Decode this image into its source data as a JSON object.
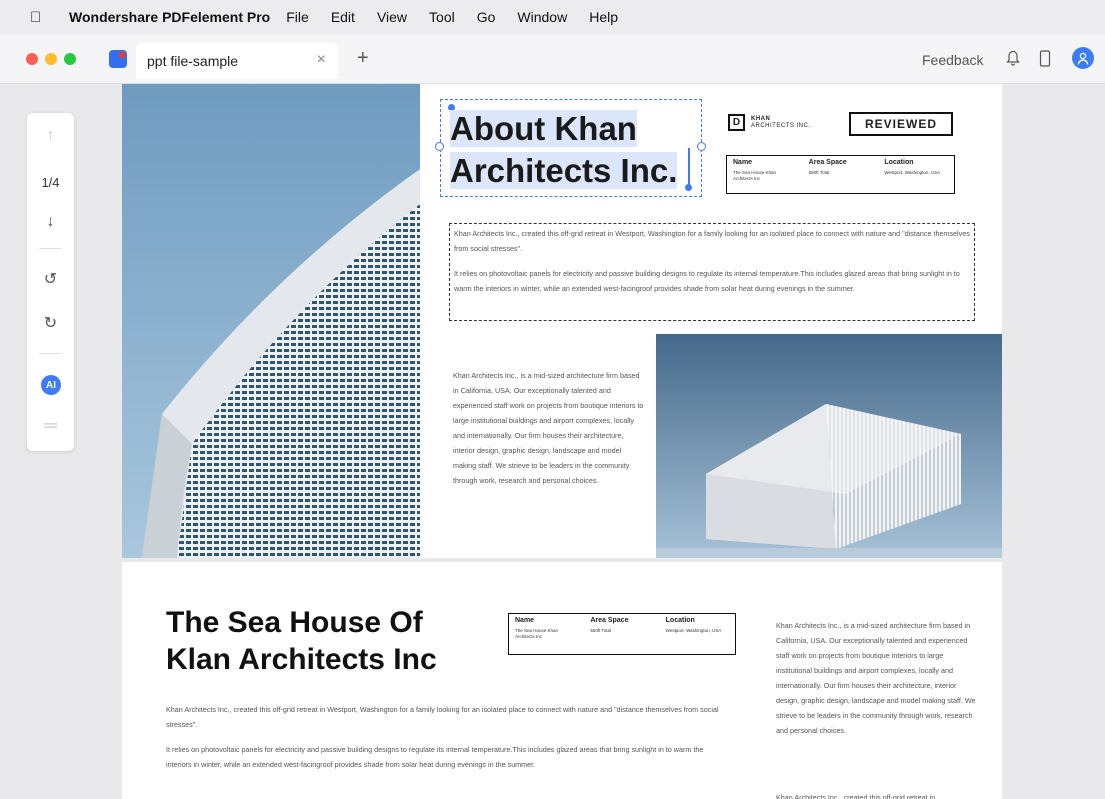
{
  "menubar": {
    "app_name": "Wondershare PDFelement Pro",
    "items": [
      "File",
      "Edit",
      "View",
      "Tool",
      "Go",
      "Window",
      "Help"
    ]
  },
  "tabbar": {
    "tab_title": "ppt file-sample",
    "feedback_label": "Feedback"
  },
  "toolbar": {
    "page_indicator": "1/4",
    "ai_label": "AI"
  },
  "doc": {
    "title_line1": "About Khan",
    "title_line2": "Architects Inc.",
    "logo_name": "KHAN",
    "logo_sub": "ARCHITECTS INC.",
    "reviewed": "REVIEWED",
    "info1": {
      "name_h": "Name",
      "name_v": "The Sea House Khan Architects Inc",
      "area_h": "Area Space",
      "area_v": "550ft Total",
      "loc_h": "Location",
      "loc_v": "Westport, Washington, USA"
    },
    "para1": "Khan Architects Inc., created this off-grid retreat in Westport, Washington for a family looking for an isolated place to connect with nature and \"distance themselves from social stresses\".",
    "para2": "It relies on photovoltaic panels for electricity and passive building designs to regulate its internal temperature.This includes glazed areas that bring sunlight in to warm the interiors in winter, while an extended west-facingroof provides shade from solar heat during evenings in the summer.",
    "para3": "Khan Architects Inc., is a mid-sized architecture firm based in California, USA. Our exceptionally talented and experienced staff work on projects from boutique interiors to large institutional buildings and airport complexes, locally and internationally. Our firm houses their architecture, interior design, graphic design, landscape and model making staff. We strieve to be leaders in the community through work, research and personal choices.",
    "title2_line1": "The Sea House Of",
    "title2_line2": "Klan Architects Inc",
    "info2": {
      "name_h": "Name",
      "name_v": "The Sea House Khan Architects Inc",
      "area_h": "Area Space",
      "area_v": "550ft Total",
      "loc_h": "Location",
      "loc_v": "Westport, Washington, USA"
    },
    "para4": "Khan Architects Inc., created this off-grid retreat in Westport, Washington for a family looking for an isolated place to connect with nature and \"distance themselves from social stresses\".",
    "para5": "It relies on photovoltaic panels for electricity and passive building designs to regulate its internal temperature.This includes glazed areas that bring sunlight in to warm the interiors in winter, while an extended west-facingroof provides shade from solar heat during evenings in the summer.",
    "para6": "Khan Architects Inc., is a mid-sized architecture firm based in California, USA. Our exceptionally talented and experienced staff work on projects from boutique interiors to large institutional buildings and airport complexes, locally and internationally. Our firm houses their architecture, interior design, graphic design, landscape and model making staff. We strieve to be leaders in the community through work, research and personal choices.",
    "para7": "Khan Architects Inc., created this off-grid retreat in"
  },
  "colors": {
    "accent": "#3d7cf5",
    "close": "#ff5f57",
    "minimize": "#febc2e",
    "zoom": "#28c840"
  }
}
